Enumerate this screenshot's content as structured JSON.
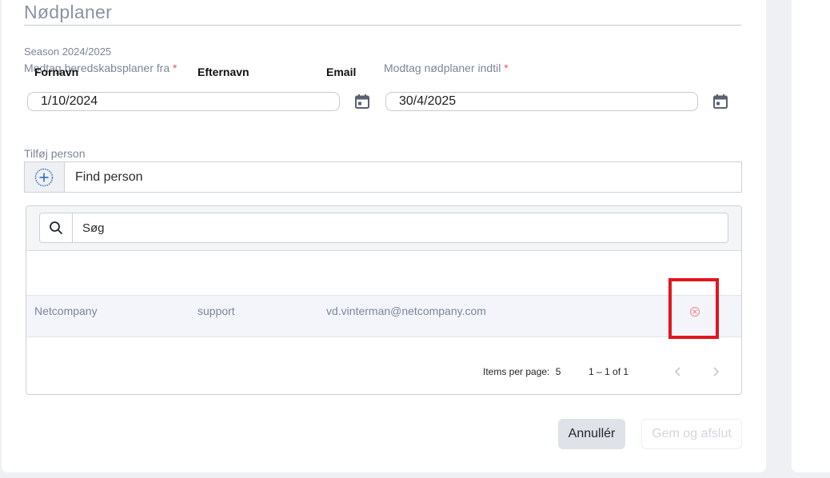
{
  "title": "Nødplaner",
  "season": "Season 2024/2025",
  "from_field": {
    "label": "Modtag beredskabsplaner fra",
    "required": "*",
    "value": "1/10/2024",
    "icon": "calendar-icon"
  },
  "to_field": {
    "label": "Modtag nødplaner indtil",
    "required": "*",
    "value": "30/4/2025",
    "icon": "calendar-icon"
  },
  "add_person": {
    "label": "Tilføj person",
    "placeholder": "Find person",
    "icon": "add-circle-icon"
  },
  "search": {
    "placeholder": "Søg",
    "icon": "search-icon"
  },
  "table": {
    "headers": [
      "Fornavn",
      "Efternavn",
      "Email"
    ],
    "rows": [
      {
        "first": "Netcompany",
        "last": "support",
        "email": "vd.vinterman@netcompany.com",
        "action_icon": "remove-circle-icon"
      }
    ]
  },
  "pagination": {
    "items_label": "Items per page:",
    "items_value": "5",
    "range": "1 – 1 of 1"
  },
  "buttons": {
    "cancel": "Annullér",
    "save": "Gem og afslut"
  },
  "colors": {
    "accent": "#2f6fbf",
    "highlight": "#e4151d",
    "required": "#e4566b"
  }
}
